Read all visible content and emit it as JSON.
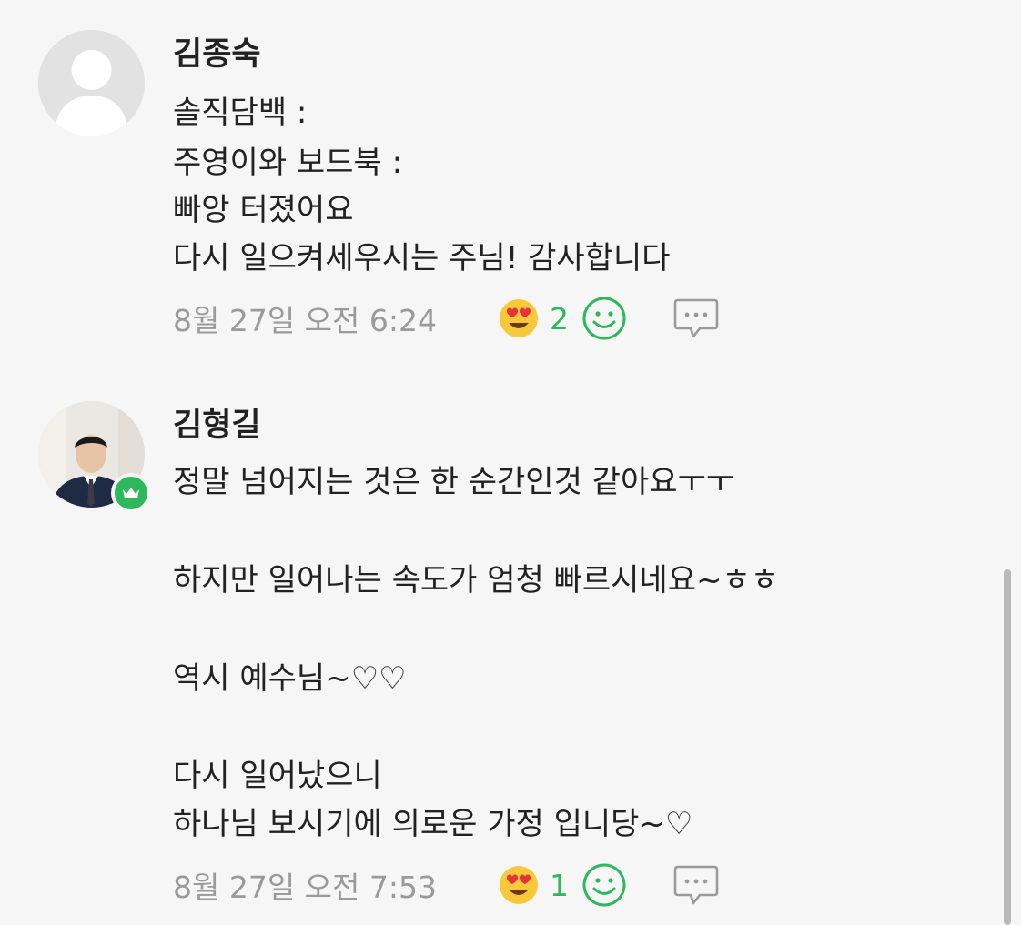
{
  "comments": [
    {
      "author": "김종숙",
      "lines": [
        "솔직담백 :",
        "주영이와 보드북  :",
        "빠앙 터졌어요",
        "다시 일으켜세우시는  주님! 감사합니다"
      ],
      "timestamp": "8월 27일 오전 6:24",
      "reaction_count": "2",
      "avatar_icon": "default-user-icon"
    },
    {
      "author": "김형길",
      "lines": [
        "정말 넘어지는 것은 한 순간인것 같아요ㅜㅜ",
        "",
        "하지만 일어나는 속도가 엄청 빠르시네요~ㅎㅎ",
        "",
        "역시 예수님~♡♡",
        "",
        "다시 일어났으니",
        "하나님 보시기에 의로운 가정 입니당~♡"
      ],
      "timestamp": "8월 27일 오전 7:53",
      "reaction_count": "1",
      "avatar_icon": "profile-photo",
      "badge_icon": "crown-icon"
    }
  ],
  "colors": {
    "accent_green": "#2db85c",
    "text": "#222222",
    "meta_gray": "#9a9a9a",
    "background": "#f6f6f6"
  }
}
